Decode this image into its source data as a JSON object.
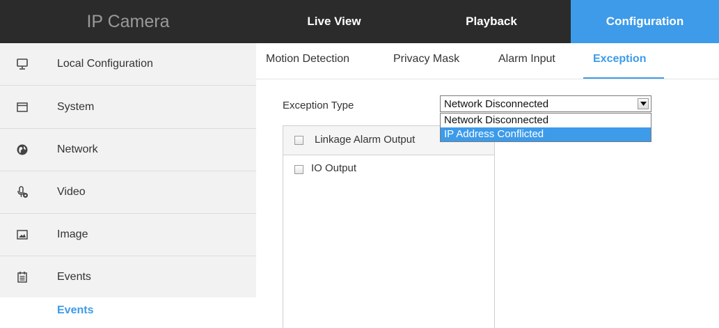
{
  "header": {
    "brand": "IP Camera",
    "tabs": [
      {
        "label": "Live View"
      },
      {
        "label": "Playback"
      },
      {
        "label": "Configuration",
        "active": true
      }
    ]
  },
  "sidebar": {
    "items": [
      {
        "label": "Local Configuration",
        "icon": "monitor-icon"
      },
      {
        "label": "System",
        "icon": "window-icon"
      },
      {
        "label": "Network",
        "icon": "globe-icon"
      },
      {
        "label": "Video",
        "icon": "microphone-icon"
      },
      {
        "label": "Image",
        "icon": "picture-icon"
      },
      {
        "label": "Events",
        "icon": "calendar-icon"
      }
    ],
    "sub_item": {
      "label": "Events",
      "active": true
    }
  },
  "subtabs": [
    {
      "label": "Motion Detection"
    },
    {
      "label": "Privacy Mask"
    },
    {
      "label": "Alarm Input"
    },
    {
      "label": "Exception",
      "active": true
    }
  ],
  "form": {
    "exception_type_label": "Exception Type",
    "exception_type_value": "Network Disconnected",
    "options": [
      "Network Disconnected",
      "IP Address Conflicted"
    ],
    "highlighted_option": "IP Address Conflicted",
    "linkage_alarm_output_label": "Linkage Alarm Output",
    "io_output_label": "IO Output"
  },
  "colors": {
    "accent": "#3d9be9",
    "topbar": "#2b2b2b",
    "sidebar_bg": "#f2f2f2"
  }
}
